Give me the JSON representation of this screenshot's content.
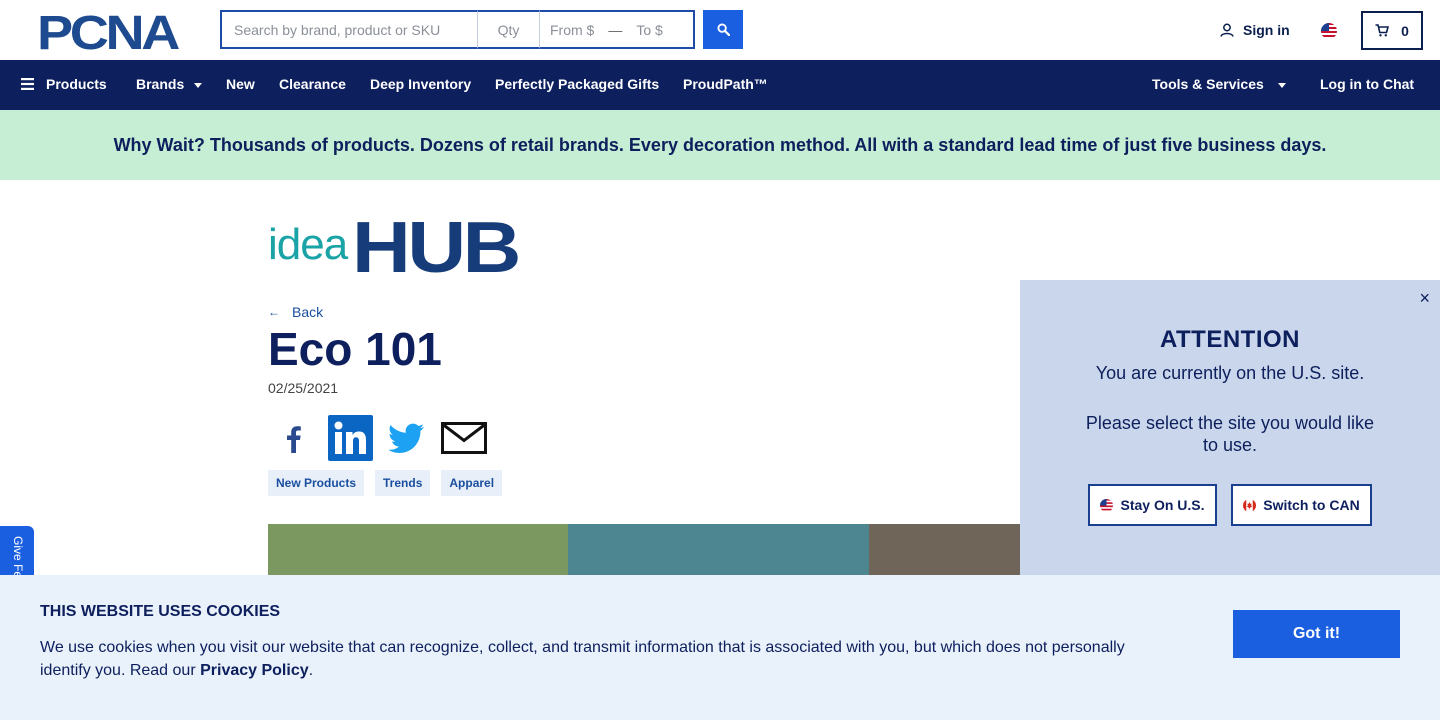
{
  "header": {
    "logo_text": "PCNA",
    "search_placeholder": "Search by brand, product or SKU",
    "qty_placeholder": "Qty",
    "price_from": "From $",
    "price_dash": "—",
    "price_to": "To $",
    "search_icon": "search-icon",
    "signin_label": "Sign in",
    "cart_count": "0"
  },
  "nav": {
    "items": [
      {
        "label": "Products",
        "icon": "hamburger-icon"
      },
      {
        "label": "Brands",
        "has_caret": true
      },
      {
        "label": "New"
      },
      {
        "label": "Clearance"
      },
      {
        "label": "Deep Inventory"
      },
      {
        "label": "Perfectly Packaged Gifts"
      },
      {
        "label": "ProudPath™"
      },
      {
        "label": "Tools & Services",
        "has_caret": true
      },
      {
        "label": "Log in to Chat"
      }
    ]
  },
  "banner": {
    "text": "Why Wait? Thousands of products. Dozens of retail brands. Every decoration method. All with a standard lead time of just five business days."
  },
  "article": {
    "logo_text_light": "idea",
    "logo_text_bold": "HUB",
    "back_label": "Back",
    "title": "Eco 101",
    "date": "02/25/2021",
    "share_icons": [
      "facebook-icon",
      "linkedin-icon",
      "twitter-icon",
      "email-icon"
    ],
    "tags": [
      "New Products",
      "Trends",
      "Apparel"
    ]
  },
  "feedback_tab": {
    "label": "Give Feedback"
  },
  "modal": {
    "close_symbol": "×",
    "title": "ATTENTION",
    "line1": "You are currently on the U.S. site.",
    "line2": "Please select the site you would like to use.",
    "stay_label": "Stay On U.S.",
    "switch_label": "Switch to CAN"
  },
  "cookies": {
    "title": "THIS WEBSITE USES COOKIES",
    "text": "We use cookies when you visit our website that can recognize, collect, and transmit information that is associated with you, but which does not personally identify you. Read our ",
    "link_label": "Privacy Policy",
    "text_end": ".",
    "button_label": "Got it!"
  },
  "colors": {
    "navy": "#0d1f5c",
    "accent_blue": "#1a5fe0",
    "banner_green": "#c6eed4",
    "teal": "#1aa3a6",
    "swatch_green": "#7a9860",
    "swatch_teal": "#4d8591",
    "swatch_brown": "#6f6558"
  }
}
